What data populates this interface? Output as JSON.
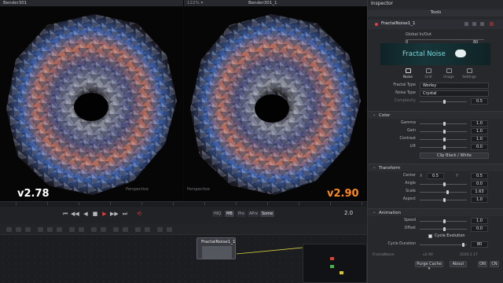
{
  "viewer_left": {
    "title": "Bender301",
    "zoom": "",
    "version_overlay": "v2.78",
    "version_color": "#ffffff"
  },
  "viewer_right": {
    "title": "Bender301_1",
    "zoom": "122% ▾",
    "version_overlay": "v2.90",
    "version_color": "#ff8a1e"
  },
  "viewer_tags": {
    "left": "Perspective",
    "right": "Perspective"
  },
  "transport": {
    "quality_buttons": [
      "HiQ",
      "MB",
      "Prx",
      "APrx",
      "Some"
    ],
    "current_time": "2.0"
  },
  "node_graph": {
    "node_label": "FractalNoise1_1"
  },
  "inspector": {
    "title": "Inspector",
    "tools_tab": "Tools",
    "tool_name": "FractalNoise1_1",
    "global_inout_label": "Global In/Out",
    "global_in": "0",
    "global_out": "80",
    "banner_text": "Fractal Noise",
    "tabs": [
      "Noise",
      "Grid",
      "Image",
      "Settings"
    ],
    "rows_noise": [
      {
        "label": "Fractal Type",
        "kind": "dropdown",
        "value": "Worley"
      },
      {
        "label": "Noise Type",
        "kind": "dropdown",
        "value": "Crystal"
      },
      {
        "label": "Complexity",
        "kind": "slider",
        "value": "0.5",
        "dim": true
      }
    ],
    "section_color": "Color",
    "rows_color": [
      {
        "label": "Gamma",
        "value": "1.0"
      },
      {
        "label": "Gain",
        "value": "1.0"
      },
      {
        "label": "Contrast",
        "value": "1.0"
      },
      {
        "label": "Lift",
        "value": "0.0"
      }
    ],
    "clip_button": "Clip Black / White",
    "section_transform": "Transform",
    "center_label": "Center",
    "center_x": "0.5",
    "center_y": "0.5",
    "rows_transform": [
      {
        "label": "Angle",
        "value": "0.0"
      },
      {
        "label": "Scale",
        "value": "1.63"
      },
      {
        "label": "Aspect",
        "value": "1.0"
      }
    ],
    "section_animation": "Animation",
    "rows_animation": [
      {
        "label": "Speed",
        "value": "1.0"
      },
      {
        "label": "Offset",
        "value": "0.0"
      }
    ],
    "cycle_evolution": "Cycle Evolution",
    "cycle_duration_label": "Cycle Duration",
    "cycle_duration_value": "80",
    "footer_left": "FractalNoise",
    "footer_mid": "v2.90",
    "footer_right": "2020.1.17",
    "purge_button": "Purge Cache ▾",
    "about_button": "About",
    "footer_btn_on": "ON",
    "footer_btn_cn": "CN"
  },
  "colors": {
    "accent_red": "#e04141",
    "orange_version": "#ff8a1e",
    "teal_banner": "#7fd6d8"
  }
}
